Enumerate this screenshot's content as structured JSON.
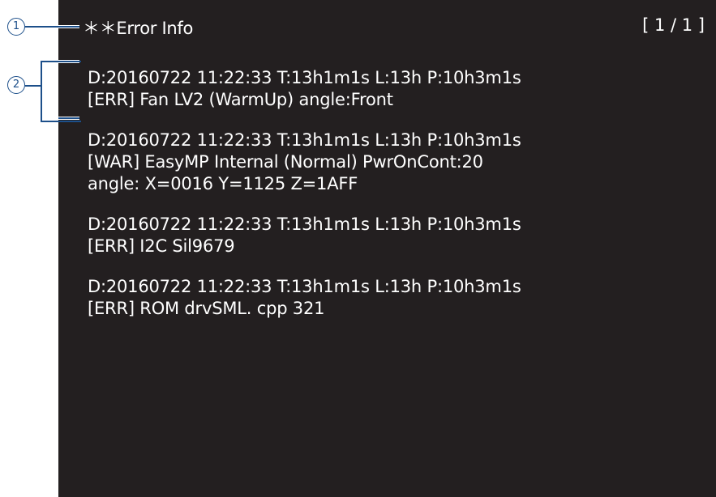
{
  "header": {
    "title": "＊＊Error Info",
    "page_indicator": "[ 1 / 1 ]"
  },
  "entries": [
    {
      "lines": [
        "D:20160722 11:22:33 T:13h1m1s L:13h P:10h3m1s",
        "[ERR] Fan LV2 (WarmUp) angle:Front"
      ]
    },
    {
      "lines": [
        "D:20160722 11:22:33 T:13h1m1s L:13h P:10h3m1s",
        "[WAR] EasyMP Internal (Normal) PwrOnCont:20",
        "angle: X=0016 Y=1125 Z=1AFF"
      ]
    },
    {
      "lines": [
        "D:20160722 11:22:33 T:13h1m1s L:13h P:10h3m1s",
        "[ERR] I2C Sil9679"
      ]
    },
    {
      "lines": [
        "D:20160722 11:22:33 T:13h1m1s L:13h P:10h3m1s",
        "[ERR] ROM drvSML. cpp 321"
      ]
    }
  ],
  "callouts": [
    {
      "number": "1"
    },
    {
      "number": "2"
    }
  ],
  "colors": {
    "screen_background": "#231f20",
    "text": "#ffffff",
    "callout": "#1c4f8a"
  }
}
